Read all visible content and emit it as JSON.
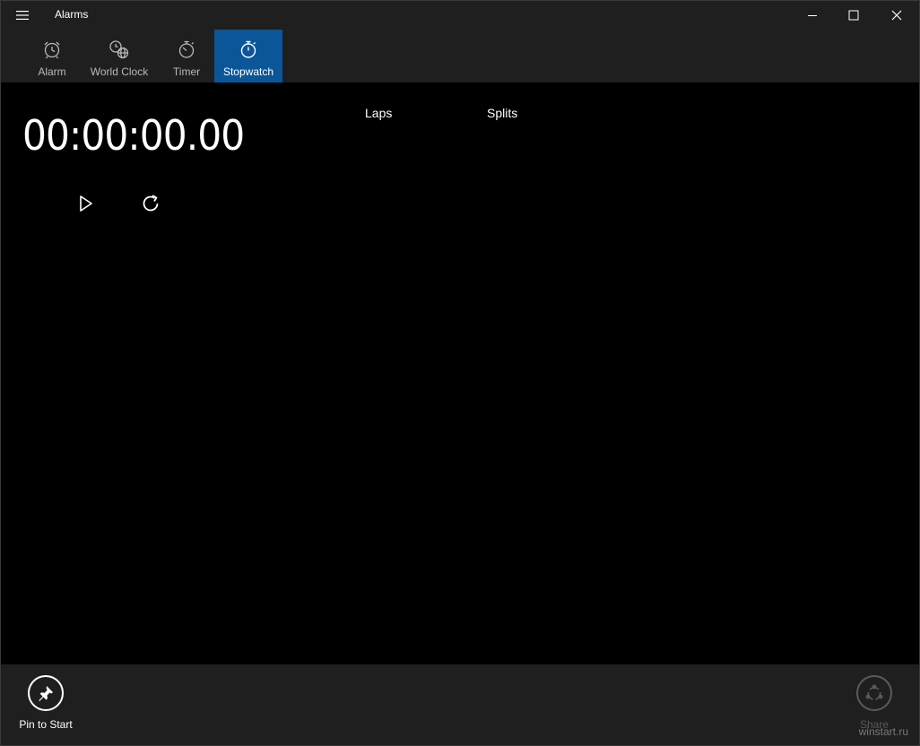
{
  "window": {
    "title": "Alarms"
  },
  "tabs": [
    {
      "label": "Alarm",
      "icon": "alarm-clock-icon",
      "active": false
    },
    {
      "label": "World Clock",
      "icon": "world-clock-icon",
      "active": false
    },
    {
      "label": "Timer",
      "icon": "timer-icon",
      "active": false
    },
    {
      "label": "Stopwatch",
      "icon": "stopwatch-icon",
      "active": true
    }
  ],
  "stopwatch": {
    "time": "00:00:00.00",
    "laps_header": "Laps",
    "splits_header": "Splits"
  },
  "appbar": {
    "pin_label": "Pin to Start",
    "share_label": "Share"
  },
  "watermark": "winstart.ru",
  "colors": {
    "accent": "#0b5698",
    "chrome": "#1f1f1f",
    "background": "#000000",
    "text": "#ffffff",
    "disabled": "#5a5a5a"
  }
}
